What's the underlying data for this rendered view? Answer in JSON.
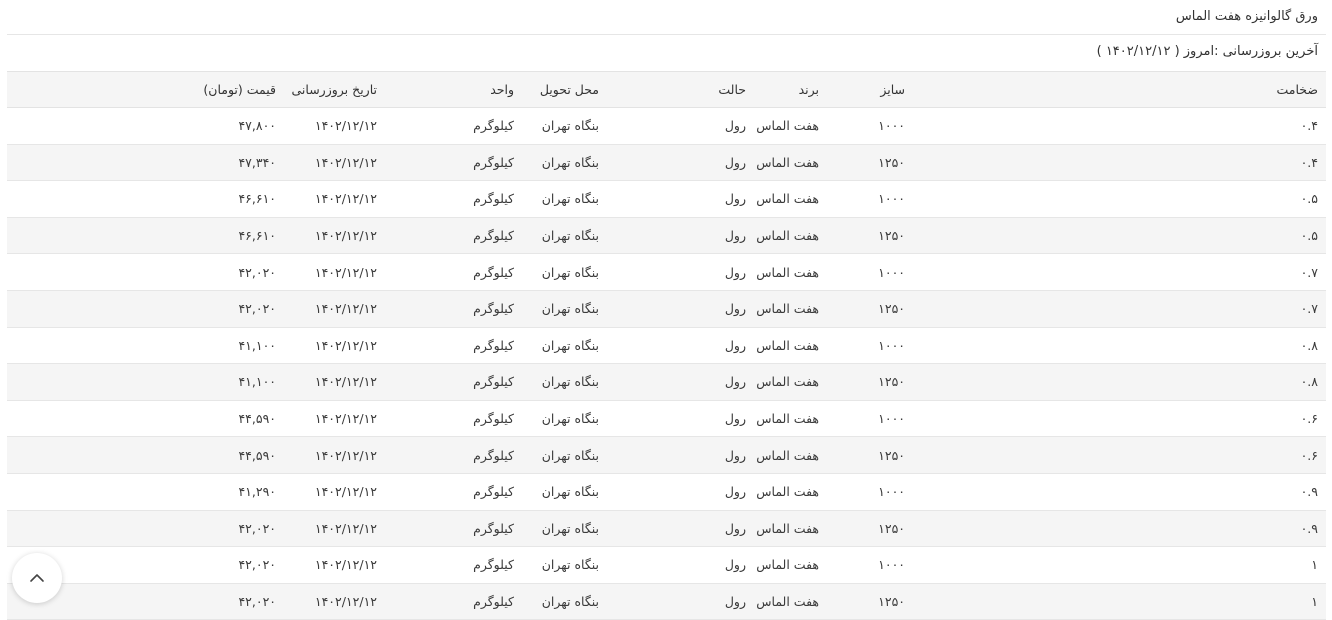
{
  "page": {
    "title": "ورق گالوانیزه هفت الماس",
    "last_update": "آخرین بروزرسانی :امروز ( ۱۴۰۲/۱۲/۱۲ )"
  },
  "table": {
    "headers": {
      "thickness": "ضخامت",
      "size": "سایز",
      "brand": "برند",
      "state": "حالت",
      "delivery": "محل تحویل",
      "unit": "واحد",
      "updated": "تاریخ بروزرسانی",
      "price": "قیمت (تومان)"
    },
    "rows": [
      {
        "thickness": "۰.۴",
        "size": "۱۰۰۰",
        "brand": "هفت الماس",
        "state": "رول",
        "delivery": "بنگاه تهران",
        "unit": "کیلوگرم",
        "updated": "۱۴۰۲/۱۲/۱۲",
        "price": "۴۷,۸۰۰"
      },
      {
        "thickness": "۰.۴",
        "size": "۱۲۵۰",
        "brand": "هفت الماس",
        "state": "رول",
        "delivery": "بنگاه تهران",
        "unit": "کیلوگرم",
        "updated": "۱۴۰۲/۱۲/۱۲",
        "price": "۴۷,۳۴۰"
      },
      {
        "thickness": "۰.۵",
        "size": "۱۰۰۰",
        "brand": "هفت الماس",
        "state": "رول",
        "delivery": "بنگاه تهران",
        "unit": "کیلوگرم",
        "updated": "۱۴۰۲/۱۲/۱۲",
        "price": "۴۶,۶۱۰"
      },
      {
        "thickness": "۰.۵",
        "size": "۱۲۵۰",
        "brand": "هفت الماس",
        "state": "رول",
        "delivery": "بنگاه تهران",
        "unit": "کیلوگرم",
        "updated": "۱۴۰۲/۱۲/۱۲",
        "price": "۴۶,۶۱۰"
      },
      {
        "thickness": "۰.۷",
        "size": "۱۰۰۰",
        "brand": "هفت الماس",
        "state": "رول",
        "delivery": "بنگاه تهران",
        "unit": "کیلوگرم",
        "updated": "۱۴۰۲/۱۲/۱۲",
        "price": "۴۲,۰۲۰"
      },
      {
        "thickness": "۰.۷",
        "size": "۱۲۵۰",
        "brand": "هفت الماس",
        "state": "رول",
        "delivery": "بنگاه تهران",
        "unit": "کیلوگرم",
        "updated": "۱۴۰۲/۱۲/۱۲",
        "price": "۴۲,۰۲۰"
      },
      {
        "thickness": "۰.۸",
        "size": "۱۰۰۰",
        "brand": "هفت الماس",
        "state": "رول",
        "delivery": "بنگاه تهران",
        "unit": "کیلوگرم",
        "updated": "۱۴۰۲/۱۲/۱۲",
        "price": "۴۱,۱۰۰"
      },
      {
        "thickness": "۰.۸",
        "size": "۱۲۵۰",
        "brand": "هفت الماس",
        "state": "رول",
        "delivery": "بنگاه تهران",
        "unit": "کیلوگرم",
        "updated": "۱۴۰۲/۱۲/۱۲",
        "price": "۴۱,۱۰۰"
      },
      {
        "thickness": "۰.۶",
        "size": "۱۰۰۰",
        "brand": "هفت الماس",
        "state": "رول",
        "delivery": "بنگاه تهران",
        "unit": "کیلوگرم",
        "updated": "۱۴۰۲/۱۲/۱۲",
        "price": "۴۴,۵۹۰"
      },
      {
        "thickness": "۰.۶",
        "size": "۱۲۵۰",
        "brand": "هفت الماس",
        "state": "رول",
        "delivery": "بنگاه تهران",
        "unit": "کیلوگرم",
        "updated": "۱۴۰۲/۱۲/۱۲",
        "price": "۴۴,۵۹۰"
      },
      {
        "thickness": "۰.۹",
        "size": "۱۰۰۰",
        "brand": "هفت الماس",
        "state": "رول",
        "delivery": "بنگاه تهران",
        "unit": "کیلوگرم",
        "updated": "۱۴۰۲/۱۲/۱۲",
        "price": "۴۱,۲۹۰"
      },
      {
        "thickness": "۰.۹",
        "size": "۱۲۵۰",
        "brand": "هفت الماس",
        "state": "رول",
        "delivery": "بنگاه تهران",
        "unit": "کیلوگرم",
        "updated": "۱۴۰۲/۱۲/۱۲",
        "price": "۴۲,۰۲۰"
      },
      {
        "thickness": "۱",
        "size": "۱۰۰۰",
        "brand": "هفت الماس",
        "state": "رول",
        "delivery": "بنگاه تهران",
        "unit": "کیلوگرم",
        "updated": "۱۴۰۲/۱۲/۱۲",
        "price": "۴۲,۰۲۰"
      },
      {
        "thickness": "۱",
        "size": "۱۲۵۰",
        "brand": "هفت الماس",
        "state": "رول",
        "delivery": "بنگاه تهران",
        "unit": "کیلوگرم",
        "updated": "۱۴۰۲/۱۲/۱۲",
        "price": "۴۲,۰۲۰"
      }
    ]
  },
  "scroll_top_button": {
    "icon": "chevron-up-icon"
  }
}
